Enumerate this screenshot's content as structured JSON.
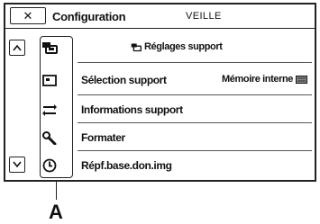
{
  "topbar": {
    "close_symbol": "✕",
    "title": "Configuration",
    "mode": "VEILLE"
  },
  "scroll": {
    "up_symbol": "^",
    "down_symbol": "v"
  },
  "menu": {
    "header": {
      "icon": "media-settings-icon",
      "label": "Réglages support"
    },
    "items": [
      {
        "icon": "media-select-icon",
        "label": "Sélection support",
        "value": "Mémoire interne"
      },
      {
        "icon": "media-info-icon",
        "label": "Informations support"
      },
      {
        "icon": "wrench-icon",
        "label": "Formater"
      },
      {
        "icon": "repair-clock-icon",
        "label": "Répf.base.don.img"
      }
    ]
  },
  "callout": {
    "label": "A"
  }
}
